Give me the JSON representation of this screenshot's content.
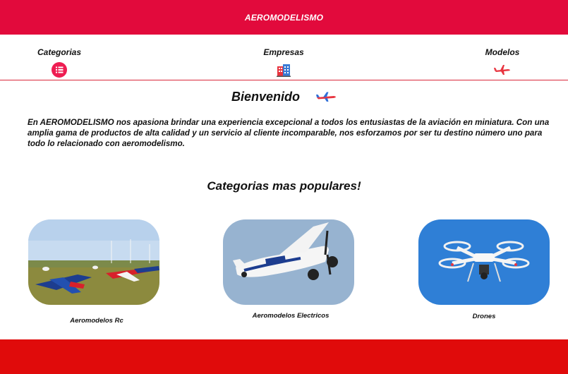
{
  "header": {
    "title": "AEROMODELISMO"
  },
  "nav": {
    "items": [
      {
        "label": "Categorias",
        "icon": "list-icon"
      },
      {
        "label": "Empresas",
        "icon": "building-icon"
      },
      {
        "label": "Modelos",
        "icon": "airplane-icon"
      }
    ]
  },
  "welcome": {
    "title": "Bienvenido",
    "text": "En AEROMODELISMO nos apasiona brindar una experiencia excepcional a todos los entusiastas de la aviación en miniatura. Con una amplia gama de productos de alta calidad y un servicio al cliente incomparable, nos esforzamos por ser tu destino número uno para todo lo relacionado con aeromodelismo."
  },
  "popular": {
    "title": "Categorias mas populares!",
    "cards": [
      {
        "label": "Aeromodelos Rc"
      },
      {
        "label": "Aeromodelos Electricos"
      },
      {
        "label": "Drones"
      }
    ]
  },
  "colors": {
    "header": "#e20a3c",
    "footer": "#e00b0b",
    "accent": "#e8343f"
  }
}
